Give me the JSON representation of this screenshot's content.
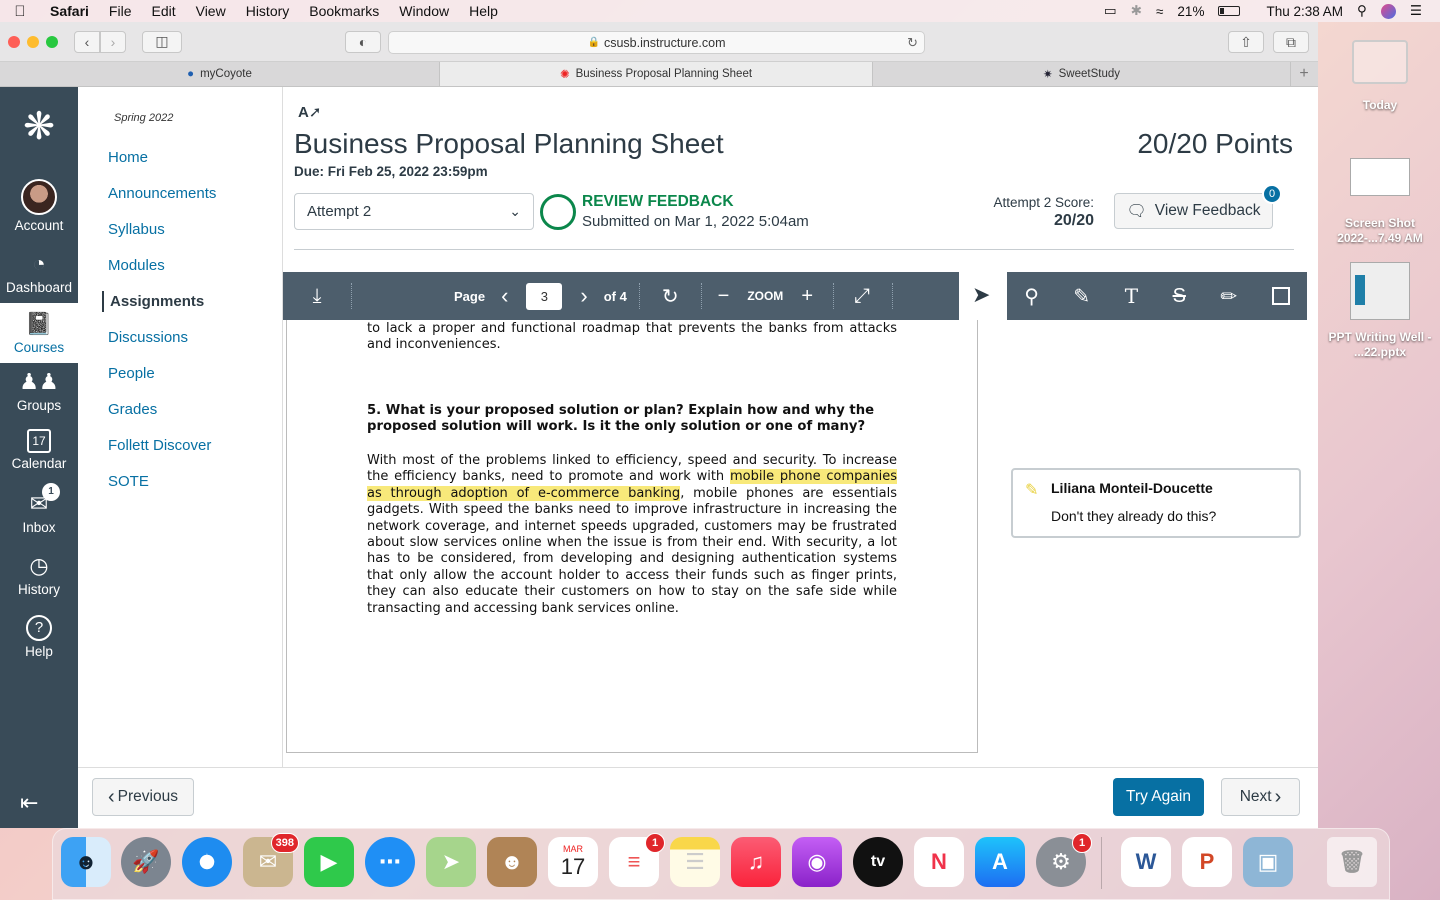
{
  "menubar": {
    "app": "Safari",
    "items": [
      "File",
      "Edit",
      "View",
      "History",
      "Bookmarks",
      "Window",
      "Help"
    ],
    "battery": "21%",
    "clock": "Thu 2:38 AM"
  },
  "browser": {
    "url": "csusb.instructure.com",
    "tabs": [
      "myCoyote",
      "Business Proposal Planning Sheet",
      "SweetStudy"
    ]
  },
  "global_nav": {
    "account": "Account",
    "dashboard": "Dashboard",
    "courses": "Courses",
    "groups": "Groups",
    "calendar": "Calendar",
    "calendar_day": "17",
    "inbox": "Inbox",
    "inbox_badge": "1",
    "history": "History",
    "help": "Help"
  },
  "course_nav": {
    "term": "Spring 2022",
    "links": [
      "Home",
      "Announcements",
      "Syllabus",
      "Modules",
      "Assignments",
      "Discussions",
      "People",
      "Grades",
      "Follett Discover",
      "SOTE"
    ]
  },
  "assignment": {
    "title": "Business Proposal Planning Sheet",
    "due": "Due: Fri Feb 25, 2022 23:59pm",
    "points": "20/20 Points",
    "attempt": "Attempt 2",
    "status": "REVIEW FEEDBACK",
    "submitted": "Submitted on Mar 1, 2022 5:04am",
    "score_label": "Attempt 2 Score:",
    "score_value": "20/20",
    "view_feedback": "View Feedback",
    "feedback_count": "0"
  },
  "viewer": {
    "page_label": "Page",
    "page_current": "3",
    "page_total": "of 4",
    "zoom_label": "ZOOM"
  },
  "document": {
    "para_top": "to lack a proper and functional roadmap that prevents the banks from attacks and inconveniences.",
    "question": "5. What is your proposed solution or plan?  Explain how and why the proposed solution will work.  Is it the only solution or one of many?",
    "answer_pre": "With most of the problems linked to efficiency, speed and security. To increase the efficiency banks, need to promote and work with ",
    "answer_highlight": "mobile phone companies as through adoption of e-commerce banking",
    "answer_post": ", mobile phones are essentials gadgets. With speed the banks need to improve infrastructure in increasing the network coverage, and internet speeds upgraded, customers may be frustrated about slow services online when the issue is from their end. With security, a lot has to be considered, from developing and designing authentication systems that only allow the account holder to access their funds such as finger prints, they can also educate their customers on how to stay on the safe side while transacting and accessing bank services online."
  },
  "comment": {
    "author": "Liliana Monteil-Doucette",
    "text": "Don't they already do this?"
  },
  "footer": {
    "previous": "Previous",
    "try_again": "Try Again",
    "next": "Next"
  },
  "desktop": {
    "today": "Today",
    "file1": "Screen Shot 2022-...7.49 AM",
    "file2": "PPT Writing Well - ...22.pptx"
  },
  "dock": {
    "mail_badge": "398",
    "calendar_month": "MAR",
    "calendar_day": "17",
    "reminders_badge": "1",
    "tv_label": "tv",
    "prefs_badge": "1"
  },
  "colors": {
    "canvas_nav": "#394b58",
    "link": "#0770a3",
    "success": "#0b874b",
    "highlight": "#f8e97a",
    "viewer_toolbar": "#4d5e6c"
  }
}
